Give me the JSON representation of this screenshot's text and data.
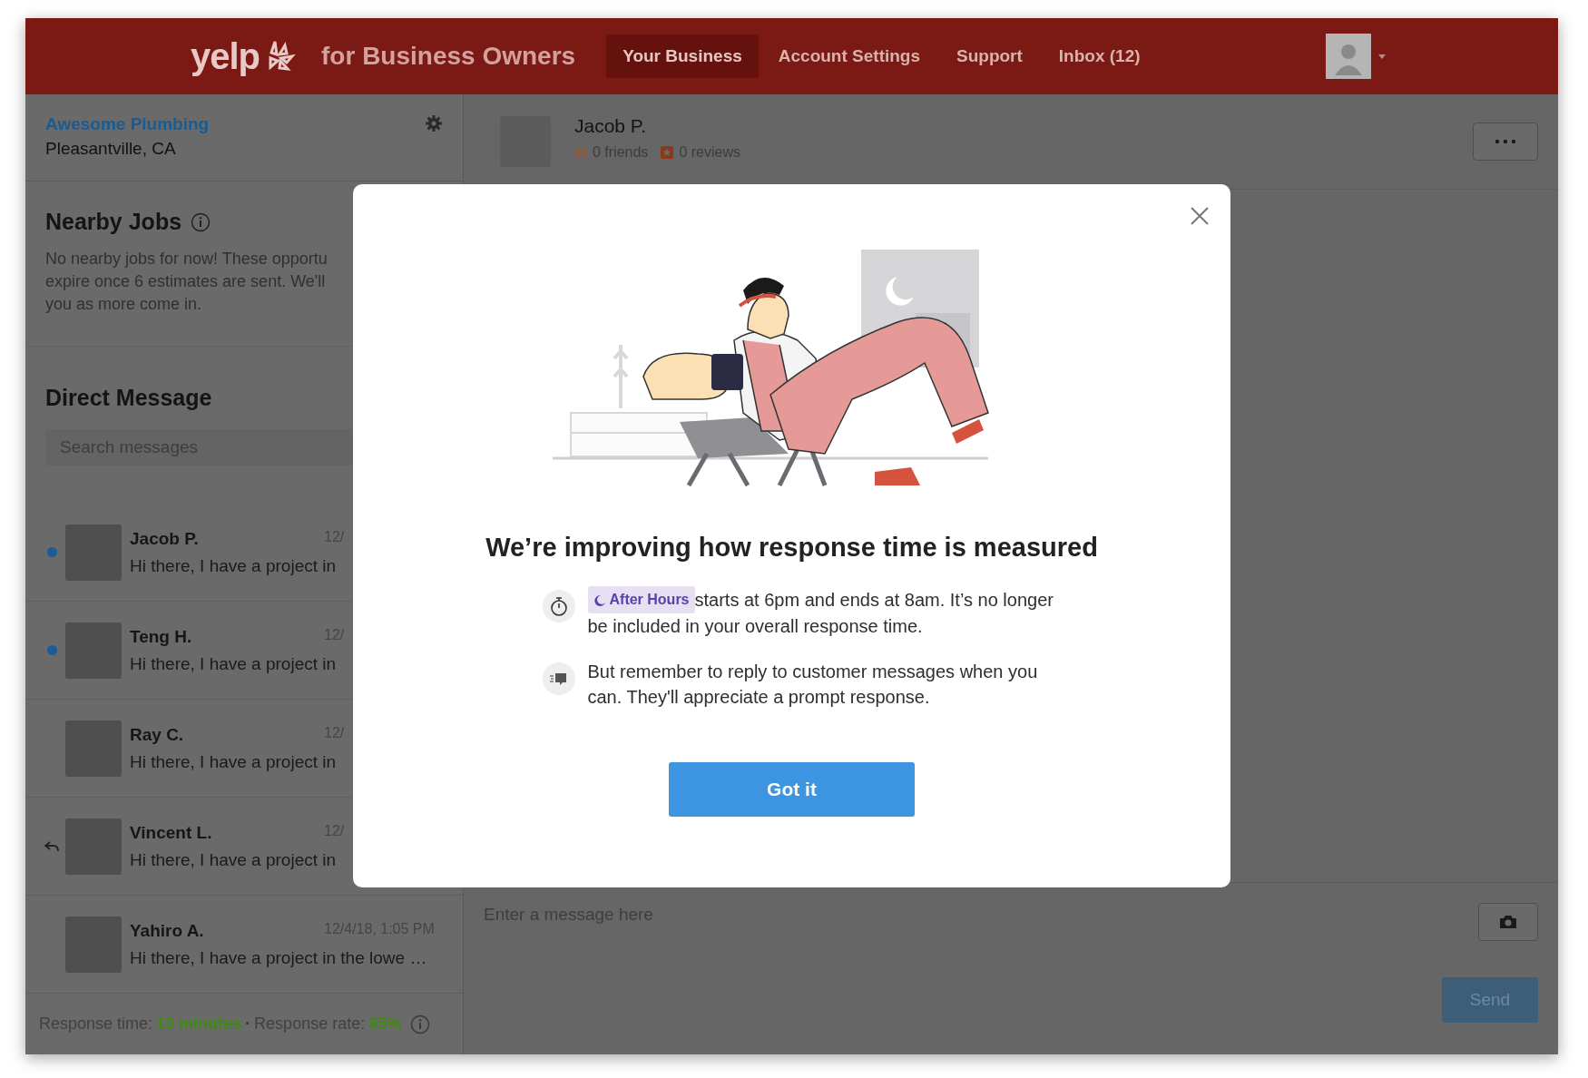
{
  "header": {
    "logo": "yelp",
    "tagline": "for Business Owners",
    "nav": [
      {
        "label": "Your Business",
        "selected": true
      },
      {
        "label": "Account Settings",
        "selected": false
      },
      {
        "label": "Support",
        "selected": false
      },
      {
        "label": "Inbox (12)",
        "selected": false
      }
    ]
  },
  "business": {
    "name": "Awesome Plumbing",
    "location": "Pleasantville, CA"
  },
  "nearby_jobs": {
    "title": "Nearby Jobs",
    "text": "No nearby jobs for now! These opportu\nexpire once 6 estimates are sent. We'll\nyou as more come in."
  },
  "direct_message": {
    "title": "Direct Message",
    "search": {
      "placeholder": "Search messages"
    }
  },
  "conversations": [
    {
      "name": "Jacob P.",
      "date": "12/",
      "preview": "Hi there, I have a project in",
      "unread": true,
      "replied": false
    },
    {
      "name": "Teng H.",
      "date": "12/",
      "preview": "Hi there, I have a project in",
      "unread": true,
      "replied": false
    },
    {
      "name": "Ray C.",
      "date": "12/",
      "preview": "Hi there, I have a project in",
      "unread": false,
      "replied": false
    },
    {
      "name": "Vincent L.",
      "date": "12/",
      "preview": "Hi there, I have a project in",
      "unread": false,
      "replied": true
    },
    {
      "name": "Yahiro A.",
      "date": "12/4/18, 1:05 PM",
      "preview": "Hi there, I have a project in the lowe …",
      "unread": false,
      "replied": false
    }
  ],
  "status_bar": {
    "time_label": "Response time:",
    "time_value": "10 minutes",
    "separator": "·",
    "rate_label": "Response rate:",
    "rate_value": "95%"
  },
  "thread": {
    "name": "Jacob P.",
    "friends": "0 friends",
    "reviews": "0 reviews",
    "composer": {
      "placeholder": "Enter a message here"
    },
    "send": "Send"
  },
  "modal": {
    "title": "We’re improving how response time is measured",
    "items": [
      {
        "kind": "timer",
        "badge": "After Hours",
        "text": "starts at 6pm and ends at 8am. It’s no longer be included in your overall response time."
      },
      {
        "kind": "chat",
        "text": "But remember to reply to customer messages when you can. They'll appreciate a prompt response."
      }
    ],
    "button": "Got it"
  }
}
